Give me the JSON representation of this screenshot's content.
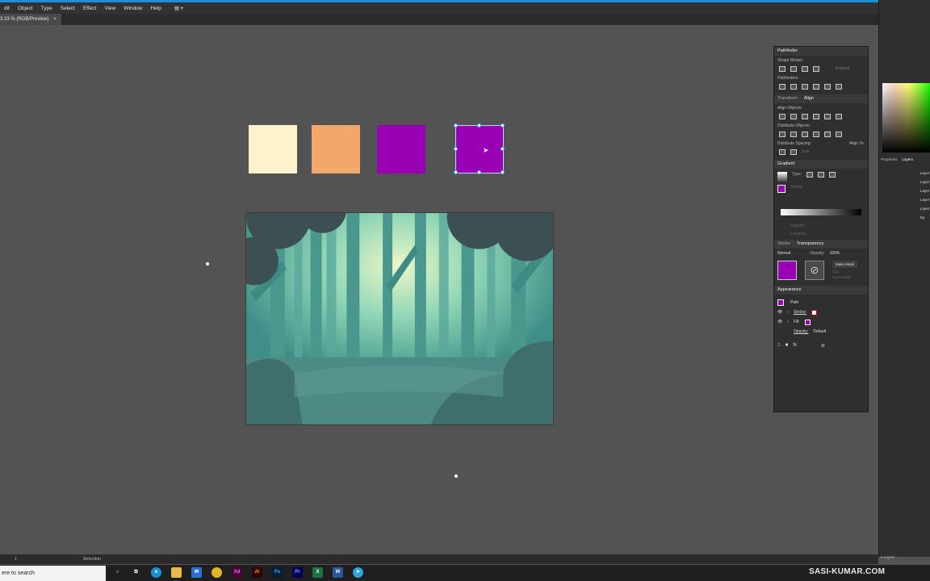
{
  "menu": [
    "Edit",
    "Object",
    "Type",
    "Select",
    "Effect",
    "View",
    "Window",
    "Help"
  ],
  "menu_first": "dit",
  "doc_tab": {
    "title": "3.33 % (RGB/Preview)",
    "close": "×"
  },
  "swatches": [
    "#FFF2CC",
    "#F2A86A",
    "#9900B4",
    "#9900B4"
  ],
  "pathfinder": {
    "title": "Pathfinder",
    "shape_modes": "Shape Modes:",
    "expand": "Expand",
    "pathfinders": "Pathfinders:"
  },
  "align": {
    "tab_transform": "Transform",
    "tab_align": "Align",
    "align_objects": "Align Objects:",
    "distribute_objects": "Distribute Objects:",
    "distribute_spacing": "Distribute Spacing:",
    "align_to": "Align To:",
    "spacing_value": "0 px"
  },
  "gradient": {
    "title": "Gradient",
    "type_label": "Type:",
    "stroke_label": "Stroke:",
    "opacity_label": "Opacity:",
    "location_label": "Location:"
  },
  "transparency": {
    "tab_stroke": "Stroke",
    "tab_transparency": "Transparency",
    "blend_mode": "Normal",
    "opacity_label": "Opacity:",
    "opacity_value": "100%",
    "make_mask": "Make Mask",
    "clip": "Clip",
    "invert_mask": "Invert Mask"
  },
  "appearance": {
    "title": "Appearance",
    "path": "Path",
    "stroke": "Stroke:",
    "fill": "Fill:",
    "opacity": "Opacity:",
    "opacity_value": "Default"
  },
  "right_panel": {
    "properties": "Properties",
    "layers": "Layers",
    "layer_count": "6 Layers",
    "layer_names": [
      "Layer",
      "Layer",
      "Layer",
      "Layer",
      "Layer",
      "bg"
    ]
  },
  "status": {
    "zoom": "1",
    "tool": "Selection"
  },
  "taskbar": {
    "search_placeholder": "ere to search",
    "apps": [
      "Xd",
      "Ai",
      "Ps",
      "Pr",
      "X",
      "W"
    ],
    "brand": "SASI-KUMAR.COM"
  },
  "colors": {
    "accent": "#9900B4",
    "ui_bg": "#535353",
    "panel": "#2F2F2F"
  }
}
